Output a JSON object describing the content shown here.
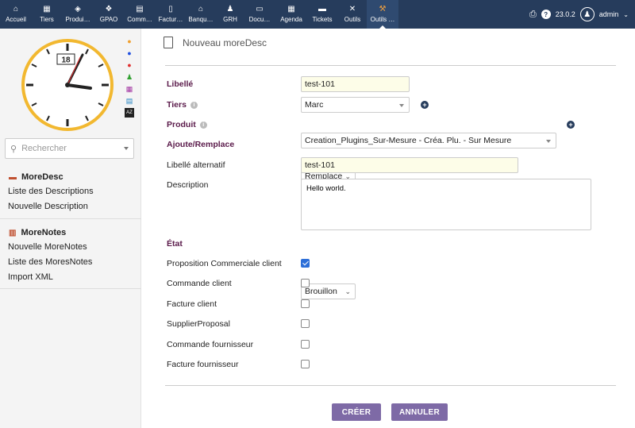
{
  "topbar": {
    "items": [
      {
        "label": "Accueil",
        "icon": "home-icon",
        "glyph": "⌂"
      },
      {
        "label": "Tiers",
        "icon": "building-icon",
        "glyph": "▦"
      },
      {
        "label": "Produi…",
        "icon": "cube-icon",
        "glyph": "◈"
      },
      {
        "label": "GPAO",
        "icon": "cubes-icon",
        "glyph": "❖"
      },
      {
        "label": "Comm…",
        "icon": "suitcase-icon",
        "glyph": "▤"
      },
      {
        "label": "Factur…",
        "icon": "invoice-icon",
        "glyph": "▯"
      },
      {
        "label": "Banqu…",
        "icon": "bank-icon",
        "glyph": "⌂"
      },
      {
        "label": "GRH",
        "icon": "user-tie-icon",
        "glyph": "♟"
      },
      {
        "label": "Docu…",
        "icon": "folder-icon",
        "glyph": "▭"
      },
      {
        "label": "Agenda",
        "icon": "calendar-icon",
        "glyph": "▦"
      },
      {
        "label": "Tickets",
        "icon": "ticket-icon",
        "glyph": "▬"
      },
      {
        "label": "Outils",
        "icon": "tools-icon",
        "glyph": "✕"
      },
      {
        "label": "Outils …",
        "icon": "tools-colored-icon",
        "glyph": "⚒"
      }
    ],
    "version": "23.0.2",
    "user": "admin"
  },
  "sidebar": {
    "clock": {
      "date": "18"
    },
    "search_placeholder": "Rechercher",
    "sections": [
      {
        "title": "MoreDesc",
        "icon": "moredesc-icon",
        "links": [
          "Liste des Descriptions",
          "Nouvelle Description"
        ]
      },
      {
        "title": "MoreNotes",
        "icon": "morenotes-icon",
        "links": [
          "Nouvelle MoreNotes",
          "Liste des MoresNotes",
          "Import XML"
        ]
      }
    ]
  },
  "page": {
    "title": "Nouveau moreDesc"
  },
  "form": {
    "libelle": {
      "label": "Libellé",
      "value": "test-101"
    },
    "tiers": {
      "label": "Tiers",
      "value": "Marc"
    },
    "produit": {
      "label": "Produit",
      "value": "Creation_Plugins_Sur-Mesure - Créa. Plu. - Sur Mesure"
    },
    "ajoute": {
      "label": "Ajoute/Remplace",
      "value": "Remplace"
    },
    "libelle_alt": {
      "label": "Libellé alternatif",
      "value": "test-101"
    },
    "description": {
      "label": "Description",
      "value": "Hello world."
    },
    "etat": {
      "label": "État",
      "value": "Brouillon"
    },
    "checks": [
      {
        "label": "Proposition Commerciale client",
        "checked": true
      },
      {
        "label": "Commande client",
        "checked": false
      },
      {
        "label": "Facture client",
        "checked": false
      },
      {
        "label": "SupplierProposal",
        "checked": false
      },
      {
        "label": "Commande fournisseur",
        "checked": false
      },
      {
        "label": "Facture fournisseur",
        "checked": false
      }
    ],
    "create_label": "CRÉER",
    "cancel_label": "ANNULER"
  },
  "colors": {
    "topbar": "#263c5c",
    "button": "#7e6aa6",
    "label_bold": "#5a1a4a",
    "checkbox_on": "#2d6fd8"
  }
}
